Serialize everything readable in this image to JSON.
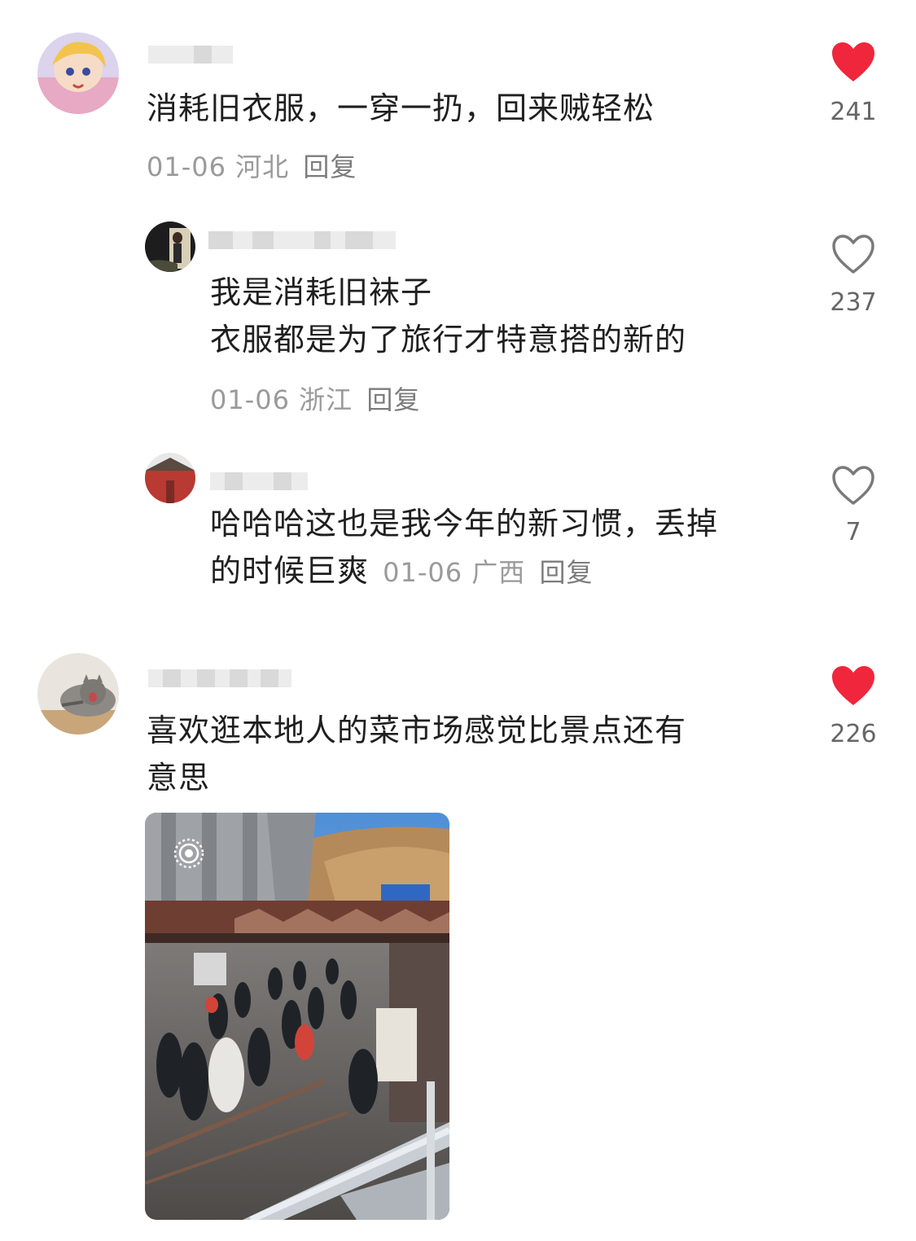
{
  "comments": [
    {
      "text_lines": [
        "消耗旧衣服，一穿一扔，回来贼轻松"
      ],
      "date": "01-06",
      "location": "河北",
      "reply_label": "回复",
      "likes": "241",
      "liked": true
    },
    {
      "text_lines": [
        "我是消耗旧袜子",
        "衣服都是为了旅行才特意搭的新的"
      ],
      "date": "01-06",
      "location": "浙江",
      "reply_label": "回复",
      "likes": "237",
      "liked": false
    },
    {
      "text_lines": [
        "哈哈哈这也是我今年的新习惯，丢掉",
        "的时候巨爽"
      ],
      "date": "01-06",
      "location": "广西",
      "reply_label": "回复",
      "likes": "7",
      "liked": false
    },
    {
      "text_lines": [
        "喜欢逛本地人的菜市场感觉比景点还有",
        "意思"
      ],
      "likes": "226",
      "liked": true,
      "image": "market-photo"
    }
  ],
  "colors": {
    "liked_heart": "#f0263c",
    "unliked_heart": "#7a7a7a",
    "meta_text": "#9a9a9a"
  },
  "icons": [
    "heart-filled-icon",
    "heart-outline-icon",
    "live-photo-icon"
  ]
}
